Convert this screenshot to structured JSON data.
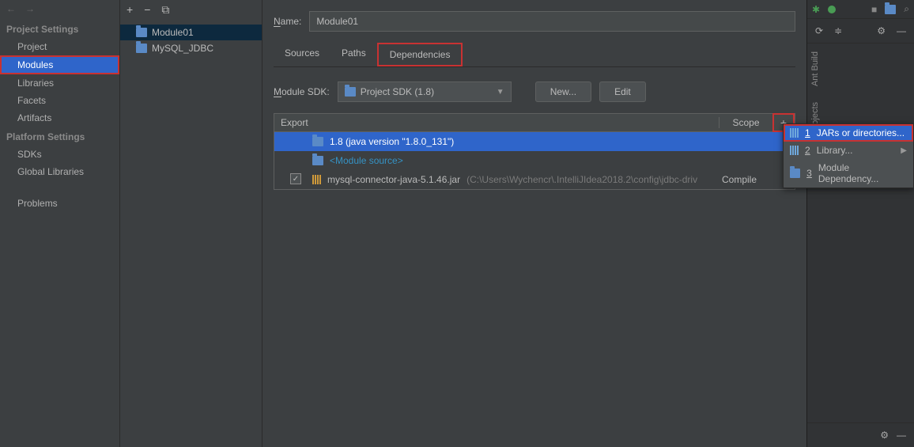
{
  "nav": {
    "project_settings": "Project Settings",
    "platform_settings": "Platform Settings",
    "items": {
      "project": "Project",
      "modules": "Modules",
      "libraries": "Libraries",
      "facets": "Facets",
      "artifacts": "Artifacts",
      "sdks": "SDKs",
      "global_libs": "Global Libraries",
      "problems": "Problems"
    }
  },
  "tree": {
    "module01": "Module01",
    "mysql": "MySQL_JDBC"
  },
  "main": {
    "name_label": "Name:",
    "name_value": "Module01",
    "tabs": {
      "sources": "Sources",
      "paths": "Paths",
      "dependencies": "Dependencies"
    },
    "sdk_label": "Module SDK:",
    "sdk_value": "Project SDK (1.8)",
    "new_btn": "New...",
    "edit_btn": "Edit",
    "th_export": "Export",
    "th_scope": "Scope",
    "rows": {
      "r1": "1.8 (java version \"1.8.0_131\")",
      "r2": "<Module source>",
      "r3_name": "mysql-connector-java-5.1.46.jar",
      "r3_path": "(C:\\Users\\Wychencr\\.IntelliJIdea2018.2\\config\\jdbc-driv",
      "r3_scope": "Compile"
    }
  },
  "menu": {
    "jars": "JARs or directories...",
    "library": "Library...",
    "module_dep": "Module Dependency..."
  },
  "vert": {
    "ant": "Ant Build",
    "maven": "Maven Projects"
  }
}
